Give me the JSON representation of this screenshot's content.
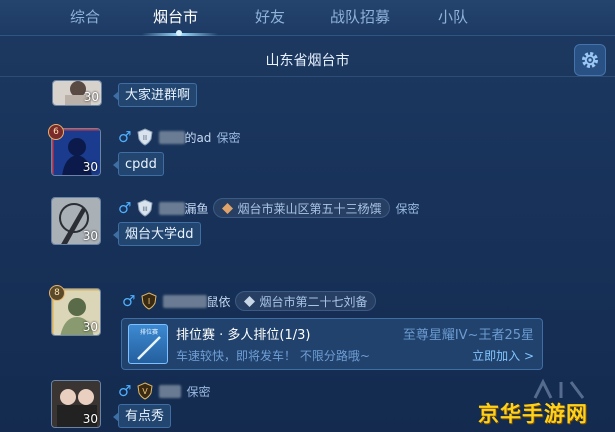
{
  "tabs": [
    {
      "label": "综合",
      "active": false
    },
    {
      "label": "烟台市",
      "active": true
    },
    {
      "label": "好友",
      "active": false
    },
    {
      "label": "战队招募",
      "active": false
    },
    {
      "label": "小队",
      "active": false
    }
  ],
  "room_title": "山东省烟台市",
  "messages": [
    {
      "level": "30",
      "text": "大家进群啊"
    },
    {
      "level": "30",
      "rank_badge": "6",
      "shield_tier": "II",
      "name_visible": "的ad",
      "privacy": "保密",
      "text": "cpdd"
    },
    {
      "level": "30",
      "shield_tier": "III",
      "name_visible": "漏鱼",
      "location": "烟台市莱山区第五十三杨馔",
      "privacy": "保密",
      "text": "烟台大学dd"
    },
    {
      "level": "30",
      "rank_badge": "8",
      "shield_tier": "I",
      "name_visible": "鼠依",
      "location": "烟台市第二十七刘备",
      "invite": {
        "icon_label": "排位赛",
        "title": "排位赛 · 多人排位(1/3)",
        "rank_range": "至尊星耀IV~王者25星",
        "description": "车速较快，即将发车！ 不限分路哦~",
        "join_label": "立即加入 >"
      }
    },
    {
      "level": "30",
      "shield_tier": "V",
      "privacy": "保密",
      "text": "有点秀"
    }
  ],
  "watermark": "京华手游网",
  "colors": {
    "accent": "#4fb0ff",
    "watermark": "#ffd21a"
  }
}
